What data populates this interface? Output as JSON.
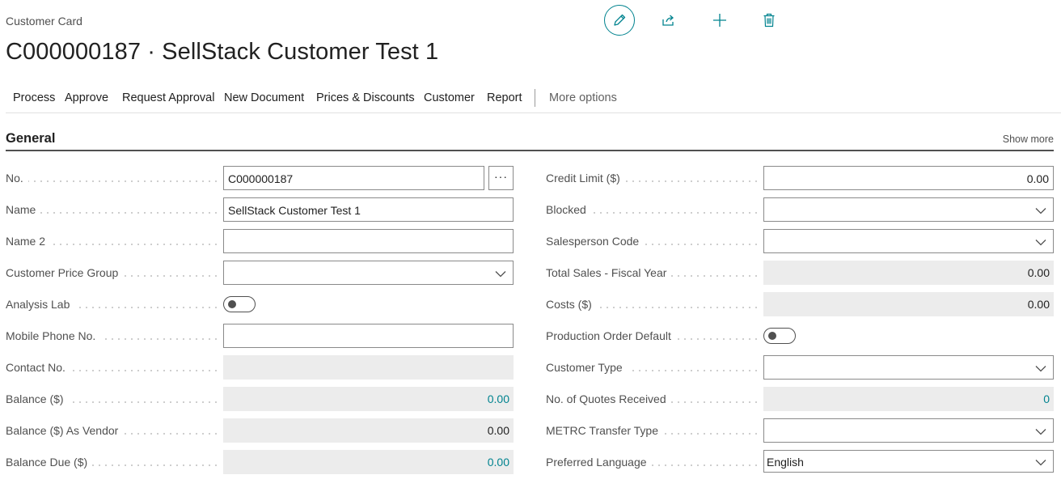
{
  "header": {
    "caption": "Customer Card",
    "title": "C000000187 · SellStack Customer Test 1"
  },
  "top_actions": {
    "edit_icon": "pencil-icon",
    "share_icon": "share-icon",
    "new_icon": "plus-icon",
    "delete_icon": "trash-icon",
    "accent": "#00838f"
  },
  "actionbar": {
    "process": "Process",
    "approve": "Approve",
    "request_approval": "Request Approval",
    "new_document": "New Document",
    "prices_discounts": "Prices & Discounts",
    "customer": "Customer",
    "report": "Report",
    "more_options": "More options"
  },
  "section": {
    "title": "General",
    "show_more": "Show more"
  },
  "left": {
    "no": {
      "label": "No.",
      "value": "C000000187"
    },
    "name": {
      "label": "Name",
      "value": "SellStack Customer Test 1"
    },
    "name2": {
      "label": "Name 2",
      "value": ""
    },
    "price_group": {
      "label": "Customer Price Group",
      "value": ""
    },
    "analysis_lab": {
      "label": "Analysis Lab",
      "value": "off"
    },
    "mobile": {
      "label": "Mobile Phone No.",
      "value": ""
    },
    "contact": {
      "label": "Contact No.",
      "value": ""
    },
    "balance": {
      "label": "Balance ($)",
      "value": "0.00"
    },
    "balance_vendor": {
      "label": "Balance ($) As Vendor",
      "value": "0.00"
    },
    "balance_due": {
      "label": "Balance Due ($)",
      "value": "0.00"
    }
  },
  "right": {
    "credit_limit": {
      "label": "Credit Limit ($)",
      "value": "0.00"
    },
    "blocked": {
      "label": "Blocked",
      "value": ""
    },
    "salesperson": {
      "label": "Salesperson Code",
      "value": ""
    },
    "total_sales": {
      "label": "Total Sales - Fiscal Year",
      "value": "0.00"
    },
    "costs": {
      "label": "Costs ($)",
      "value": "0.00"
    },
    "prod_order_default": {
      "label": "Production Order Default",
      "value": "off"
    },
    "customer_type": {
      "label": "Customer Type",
      "value": ""
    },
    "quotes_received": {
      "label": "No. of Quotes Received",
      "value": "0"
    },
    "metrc_transfer": {
      "label": "METRC Transfer Type",
      "value": ""
    },
    "preferred_language": {
      "label": "Preferred Language",
      "value": "English"
    }
  }
}
